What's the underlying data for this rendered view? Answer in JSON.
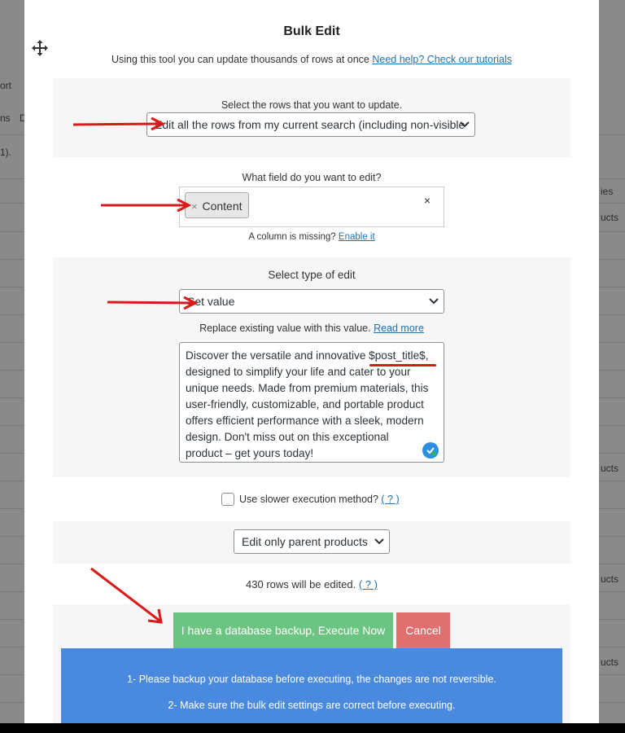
{
  "background": {
    "left_fragments": [
      "ort",
      "ns",
      "D",
      "1)."
    ],
    "right_fragments": [
      "ies",
      "ucts",
      "ucts",
      "ucts",
      "ucts"
    ]
  },
  "modal": {
    "title": "Bulk Edit",
    "subtitle": "Using this tool you can update thousands of rows at once",
    "help_link": "Need help? Check our tutorials",
    "rows_section": {
      "label": "Select the rows that you want to update.",
      "selected": "Edit all the rows from my current search (including non-visible"
    },
    "field_section": {
      "label": "What field do you want to edit?",
      "token_remove": "×",
      "token": "Content",
      "clear": "×",
      "missing_text": "A column is missing?",
      "missing_link": "Enable it"
    },
    "edit_type_section": {
      "label": "Select type of edit",
      "selected": "Set value",
      "help_text": "Replace existing value with this value.",
      "help_link": "Read more",
      "value_lines": [
        "Discover the versatile and innovative $post_title$,",
        "designed to simplify your life and cater to your",
        "unique needs. Made from premium materials, this",
        "user-friendly, customizable, and portable product",
        "offers efficient performance with a sleek, modern",
        "design. Don't miss out on this exceptional",
        "product – get yours today!"
      ]
    },
    "slower_method": {
      "label": "Use slower execution method?",
      "help": "( ? )",
      "checked": false
    },
    "parent_filter": {
      "selected": "Edit only parent products"
    },
    "rows_count": {
      "text": "430 rows will be edited.",
      "help": "( ? )"
    },
    "buttons": {
      "execute": "I have a database backup, Execute Now",
      "cancel": "Cancel"
    },
    "notice": {
      "line1": "1- Please backup your database before executing, the changes are not reversible.",
      "line2": "2- Make sure the bulk edit settings are correct before executing."
    }
  },
  "colors": {
    "accent_link": "#2271b1",
    "execute_green": "#6bc482",
    "cancel_red": "#e07070",
    "notice_blue": "#4a8ade",
    "annotation_red": "#d91a1a"
  }
}
